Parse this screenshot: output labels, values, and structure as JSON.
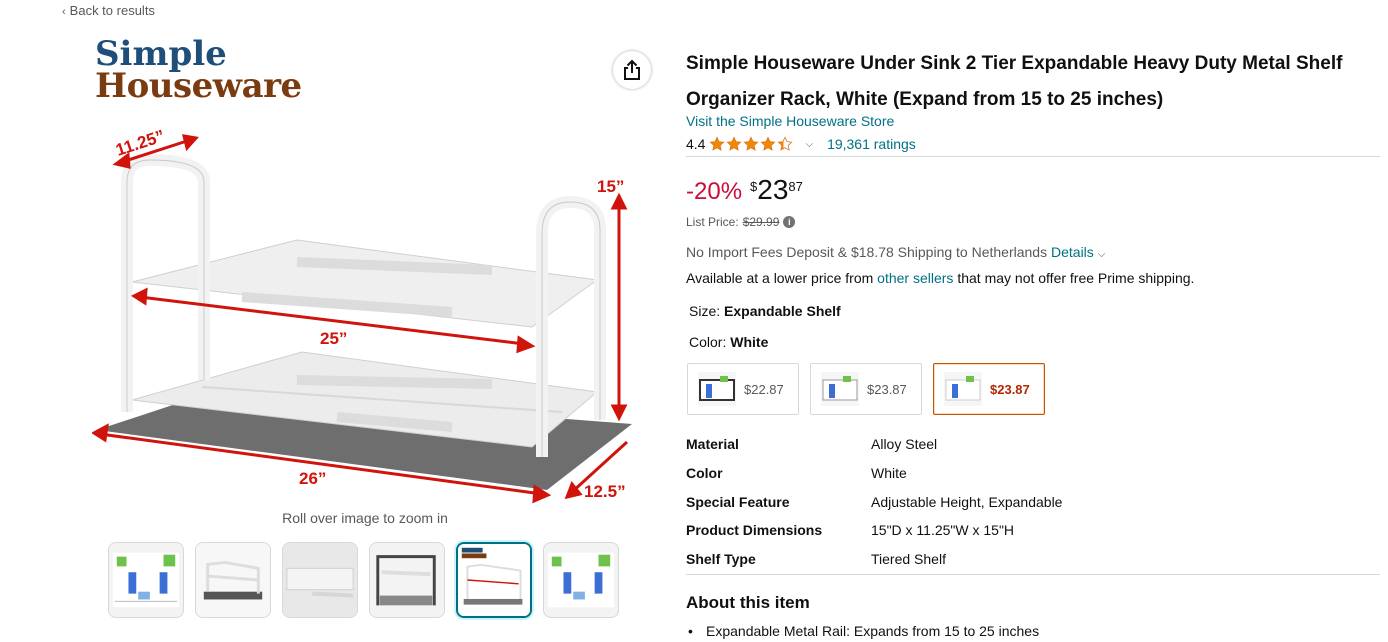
{
  "nav": {
    "back_label": "Back to results"
  },
  "brand": {
    "line1": "Simple",
    "line2": "Houseware"
  },
  "gallery": {
    "zoom_hint": "Roll over image to zoom in",
    "dimensions": {
      "depth": "11.25”",
      "height": "15”",
      "inner_width": "25”",
      "outer_width": "26”",
      "mat_depth": "12.5”"
    },
    "thumbnail_count": 6,
    "selected_thumbnail": 4
  },
  "product": {
    "title": "Simple Houseware Under Sink 2 Tier Expandable Heavy Duty Metal Shelf Organizer Rack, White (Expand from 15 to 25 inches)",
    "store_link": "Visit the Simple Houseware Store",
    "rating_value": "4.4",
    "rating_stars": 4.4,
    "ratings_count": "19,361 ratings",
    "discount": "-20%",
    "price_currency": "$",
    "price_whole": "23",
    "price_fraction": "87",
    "list_price_label": "List Price:",
    "list_price": "$29.99",
    "shipping_text": "No Import Fees Deposit & $18.78 Shipping to Netherlands",
    "shipping_details_link": "Details",
    "lower_price_prefix": "Available at a lower price from",
    "lower_price_link": "other sellers",
    "lower_price_suffix": "that may not offer free Prime shipping."
  },
  "variations": {
    "size_label": "Size:",
    "size_value": "Expandable Shelf",
    "color_label": "Color:",
    "color_value": "White",
    "swatches": [
      {
        "price": "$22.87",
        "selected": false
      },
      {
        "price": "$23.87",
        "selected": false
      },
      {
        "price": "$23.87",
        "selected": true
      }
    ]
  },
  "specs": [
    {
      "key": "Material",
      "value": "Alloy Steel"
    },
    {
      "key": "Color",
      "value": "White"
    },
    {
      "key": "Special Feature",
      "value": "Adjustable Height, Expandable"
    },
    {
      "key": "Product Dimensions",
      "value": "15\"D x 11.25\"W x 15\"H"
    },
    {
      "key": "Shelf Type",
      "value": "Tiered Shelf"
    }
  ],
  "about": {
    "title": "About this item",
    "bullets": [
      "Expandable Metal Rail: Expands from 15 to 25 inches"
    ]
  },
  "colors": {
    "link": "#007185",
    "discount": "#cc0c39",
    "star": "#f08804",
    "brand_blue": "#1f4e7a",
    "brand_brown": "#7a3b10",
    "dimension_red": "#d0140c"
  }
}
